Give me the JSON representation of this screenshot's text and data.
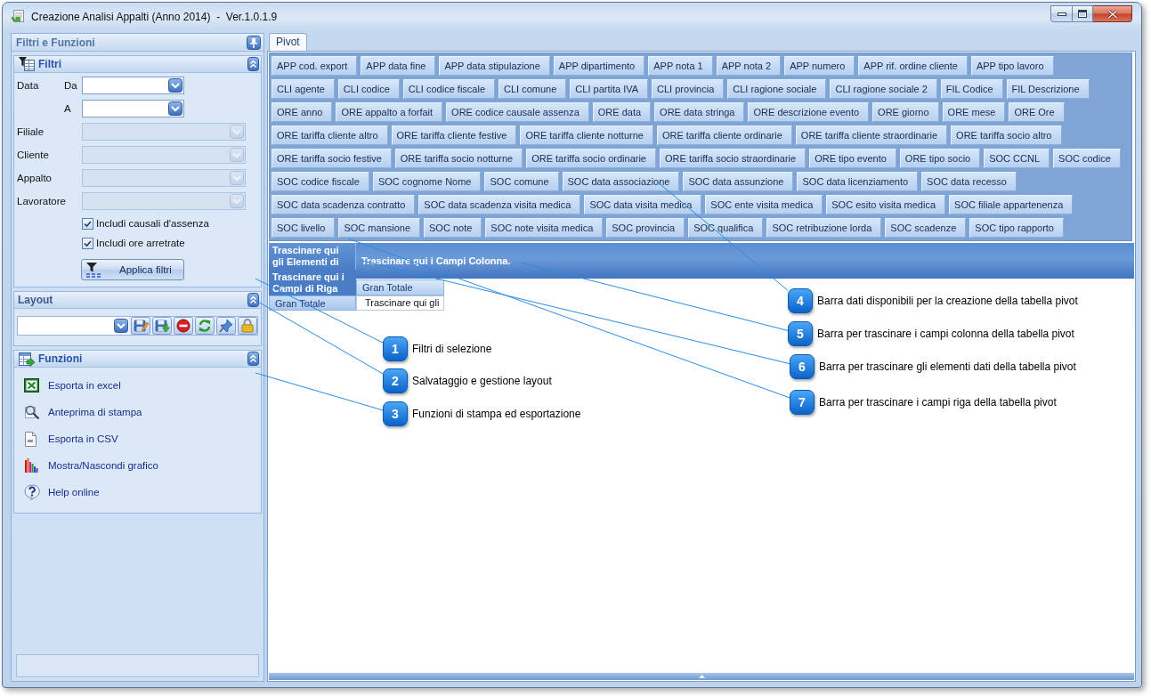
{
  "window": {
    "title": "Creazione Analisi Appalti (Anno 2014)  -  Ver.1.0.1.9"
  },
  "side_panel": {
    "title": "Filtri e Funzioni",
    "filters": {
      "title": "Filtri",
      "expanded": true,
      "fields": [
        {
          "kind": "date",
          "label": "Data",
          "sublabel": "Da",
          "disabled": false
        },
        {
          "kind": "date",
          "sublabel": "A",
          "disabled": false
        },
        {
          "kind": "combo",
          "label": "Filiale",
          "disabled": true
        },
        {
          "kind": "combo",
          "label": "Cliente",
          "disabled": true
        },
        {
          "kind": "combo",
          "label": "Appalto",
          "disabled": true
        },
        {
          "kind": "combo",
          "label": "Lavoratore",
          "disabled": true
        }
      ],
      "checkboxes": [
        {
          "label": "Includi causali d'assenza",
          "checked": true
        },
        {
          "label": "Includi ore arretrate",
          "checked": true
        }
      ],
      "apply_button": "Applica filtri"
    },
    "layout": {
      "title": "Layout",
      "expanded": true
    },
    "functions": {
      "title": "Funzioni",
      "expanded": true,
      "items": [
        "Esporta in excel",
        "Anteprima di stampa",
        "Esporta in CSV",
        "Mostra/Nascondi grafico",
        "Help online"
      ]
    }
  },
  "tabs": [
    {
      "label": "Pivot",
      "selected": true
    }
  ],
  "pivot": {
    "field_rows": [
      [
        "APP cod. export",
        "APP data fine",
        "APP data stipulazione",
        "APP dipartimento",
        "APP nota 1",
        "APP nota 2",
        "APP numero",
        "APP rif. ordine cliente",
        "APP tipo lavoro"
      ],
      [
        "CLI agente",
        "CLI codice",
        "CLI codice fiscale",
        "CLI comune",
        "CLI partita IVA",
        "CLI provincia",
        "CLI ragione sociale",
        "CLI ragione sociale 2",
        "FIL Codice",
        "FIL Descrizione"
      ],
      [
        "ORE anno",
        "ORE appalto a forfait",
        "ORE codice causale assenza",
        "ORE data",
        "ORE data stringa",
        "ORE descrizione evento",
        "ORE giorno",
        "ORE mese",
        "ORE Ore"
      ],
      [
        "ORE tariffa cliente altro",
        "ORE tariffa cliente festive",
        "ORE tariffa cliente notturne",
        "ORE tariffa cliente ordinarie",
        "ORE tariffa cliente straordinarie",
        "ORE tariffa socio altro"
      ],
      [
        "ORE tariffa socio festive",
        "ORE tariffa socio notturne",
        "ORE tariffa socio ordinarie",
        "ORE tariffa socio straordinarie",
        "ORE tipo evento",
        "ORE tipo socio",
        "SOC CCNL",
        "SOC codice"
      ],
      [
        "SOC codice fiscale",
        "SOC cognome Nome",
        "SOC comune",
        "SOC data associazione",
        "SOC data assunzione",
        "SOC data licenziamento",
        "SOC data recesso"
      ],
      [
        "SOC data scadenza contratto",
        "SOC data scadenza visita medica",
        "SOC data visita medica",
        "SOC ente visita medica",
        "SOC esito visita medica",
        "SOC filiale appartenenza"
      ],
      [
        "SOC livello",
        "SOC mansione",
        "SOC note",
        "SOC note visita medica",
        "SOC provincia",
        "SOC qualifica",
        "SOC retribuzione lorda",
        "SOC scadenze",
        "SOC tipo rapporto"
      ]
    ],
    "data_area": "Trascinare qui gli Elementi di",
    "column_area": "Trascinare qui i Campi Colonna.",
    "row_area": "Trascinare qui i Campi di Riga",
    "column_header": "Gran Totale",
    "row_header": "Gran Totale",
    "cell": "Trascinare qui gli"
  },
  "callouts": [
    {
      "number": "1",
      "text": "Filtri di selezione"
    },
    {
      "number": "2",
      "text": "Salvataggio e gestione layout"
    },
    {
      "number": "3",
      "text": "Funzioni di stampa ed esportazione"
    },
    {
      "number": "4",
      "text": "Barra dati disponibili per la creazione della tabella pivot"
    },
    {
      "number": "5",
      "text": "Barra per trascinare i campi colonna della tabella pivot"
    },
    {
      "number": "6",
      "text": "Barra per trascinare gli elementi dati della tabella pivot"
    },
    {
      "number": "7",
      "text": "Barra per trascinare i campi riga della tabella pivot"
    }
  ]
}
